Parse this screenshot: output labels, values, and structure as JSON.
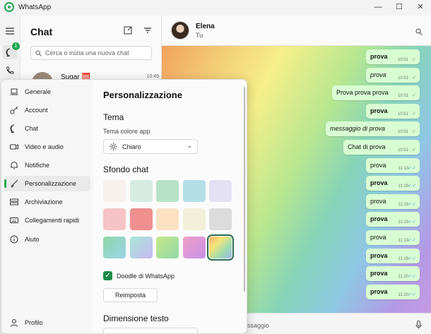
{
  "titlebar": {
    "title": "WhatsApp",
    "minimize": "—",
    "maximize": "☐",
    "close": "✕"
  },
  "rail": {
    "unread_badge": "1"
  },
  "chatlist": {
    "title": "Chat",
    "search_placeholder": "Cerca o inizia una nuova chat",
    "peek_contact": {
      "name": "Sugar 🆘",
      "time": "10:49"
    }
  },
  "chat": {
    "contact_name": "Elena",
    "contact_sub": "Tu",
    "composer_placeholder": "ssaggio",
    "messages": [
      {
        "text": "prova",
        "time": "10:51",
        "bold": true,
        "italic": false,
        "read": false
      },
      {
        "text": "prova",
        "time": "10:51",
        "bold": false,
        "italic": true,
        "read": false
      },
      {
        "text": "Prova prova prova",
        "time": "10:51",
        "bold": false,
        "italic": false,
        "read": false
      },
      {
        "text": "prova",
        "time": "10:51",
        "bold": true,
        "italic": false,
        "read": false
      },
      {
        "text": "messaggio di prova",
        "time": "10:51",
        "bold": false,
        "italic": true,
        "read": false
      },
      {
        "text": "Chat di prova",
        "time": "10:51",
        "bold": false,
        "italic": false,
        "read": false
      },
      {
        "text": "prova",
        "time": "11:10",
        "bold": false,
        "italic": false,
        "read": true
      },
      {
        "text": "prova",
        "time": "11:19",
        "bold": true,
        "italic": false,
        "read": true
      },
      {
        "text": "prova",
        "time": "11:19",
        "bold": false,
        "italic": false,
        "read": true
      },
      {
        "text": "prova",
        "time": "11:19",
        "bold": true,
        "italic": false,
        "read": true
      },
      {
        "text": "prova",
        "time": "11:19",
        "bold": false,
        "italic": false,
        "read": true
      },
      {
        "text": "prova",
        "time": "11:19",
        "bold": true,
        "italic": false,
        "read": true
      },
      {
        "text": "prova",
        "time": "11:20",
        "bold": true,
        "italic": false,
        "read": true
      },
      {
        "text": "prova",
        "time": "11:20",
        "bold": true,
        "italic": false,
        "read": true
      }
    ]
  },
  "settings": {
    "nav": [
      {
        "label": "Generale",
        "icon": "laptop-icon",
        "active": false
      },
      {
        "label": "Account",
        "icon": "key-icon",
        "active": false
      },
      {
        "label": "Chat",
        "icon": "chat-icon",
        "active": false
      },
      {
        "label": "Video e audio",
        "icon": "video-icon",
        "active": false
      },
      {
        "label": "Notifiche",
        "icon": "bell-icon",
        "active": false
      },
      {
        "label": "Personalizzazione",
        "icon": "brush-icon",
        "active": true
      },
      {
        "label": "Archiviazione",
        "icon": "storage-icon",
        "active": false
      },
      {
        "label": "Collegamenti rapidi",
        "icon": "keyboard-icon",
        "active": false
      },
      {
        "label": "Aiuto",
        "icon": "info-icon",
        "active": false
      }
    ],
    "profile_label": "Profilo",
    "pane": {
      "title": "Personalizzazione",
      "theme_heading": "Tema",
      "theme_sub": "Tema colore app",
      "theme_value": "Chiaro",
      "bg_heading": "Sfondo chat",
      "swatches": [
        "#f7f1ee",
        "#d6ece3",
        "#b8e2c8",
        "#b5dfe8",
        "#e5e1f4",
        "#f6c3c6",
        "#ef8f8f",
        "#fde1c3",
        "#f2f0d8",
        "#dcdcdc",
        "linear-gradient(135deg,#8fd8a8,#9bd3e8)",
        "linear-gradient(135deg,#a8e8d8,#c8b8f0)",
        "linear-gradient(135deg,#c8e88a,#8fd8a8)",
        "linear-gradient(135deg,#f0a0c8,#c890e8)",
        "linear-gradient(135deg,#f6b26b,#f3e47a,#9fdcb0,#9ab6e8)"
      ],
      "selected_swatch": 14,
      "doodle_label": "Doodle di WhatsApp",
      "doodle_checked": true,
      "reset_label": "Reimposta",
      "text_size_heading": "Dimensione testo"
    }
  }
}
